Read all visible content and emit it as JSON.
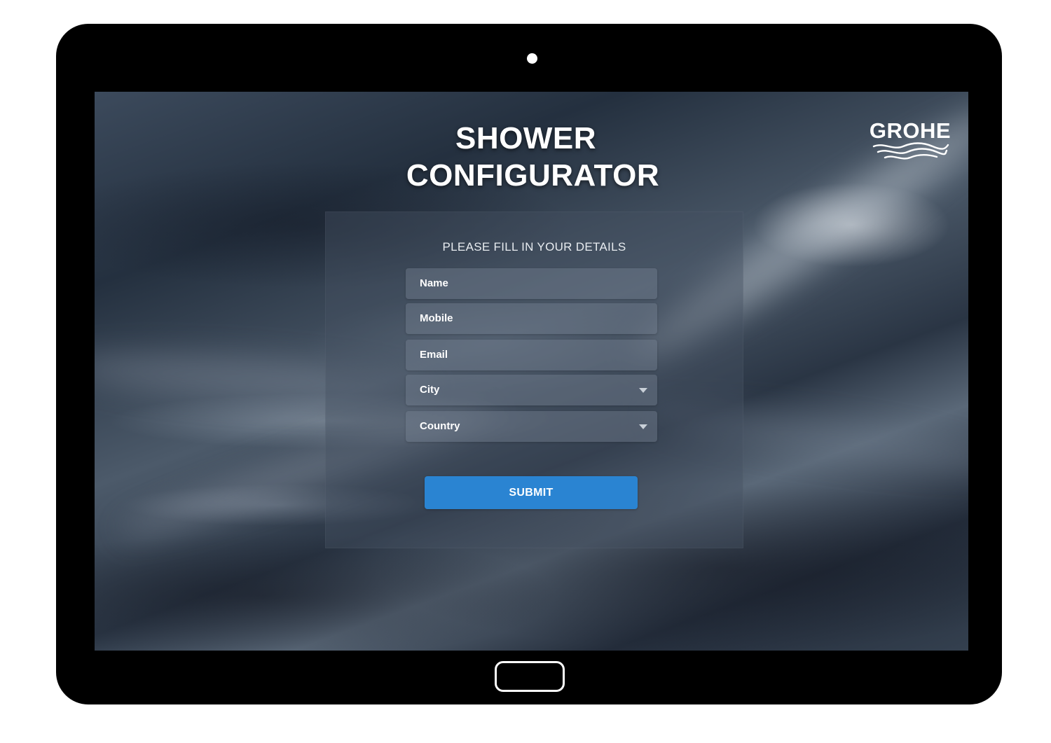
{
  "app": {
    "title_line_1": "SHOWER",
    "title_line_2": "CONFIGURATOR",
    "brand": "GROHE",
    "brand_icon": "grohe-waves-logo"
  },
  "form": {
    "heading": "PLEASE FILL IN YOUR DETAILS",
    "fields": [
      {
        "label": "Name",
        "type": "text"
      },
      {
        "label": "Mobile",
        "type": "text"
      },
      {
        "label": "Email",
        "type": "text"
      },
      {
        "label": "City",
        "type": "select",
        "icon": "chevron-down-icon"
      },
      {
        "label": "Country",
        "type": "select",
        "icon": "chevron-down-icon"
      }
    ],
    "submit_label": "SUBMIT"
  },
  "colors": {
    "accent": "#2a84d2",
    "text": "#ffffff",
    "device_frame": "#000000"
  }
}
